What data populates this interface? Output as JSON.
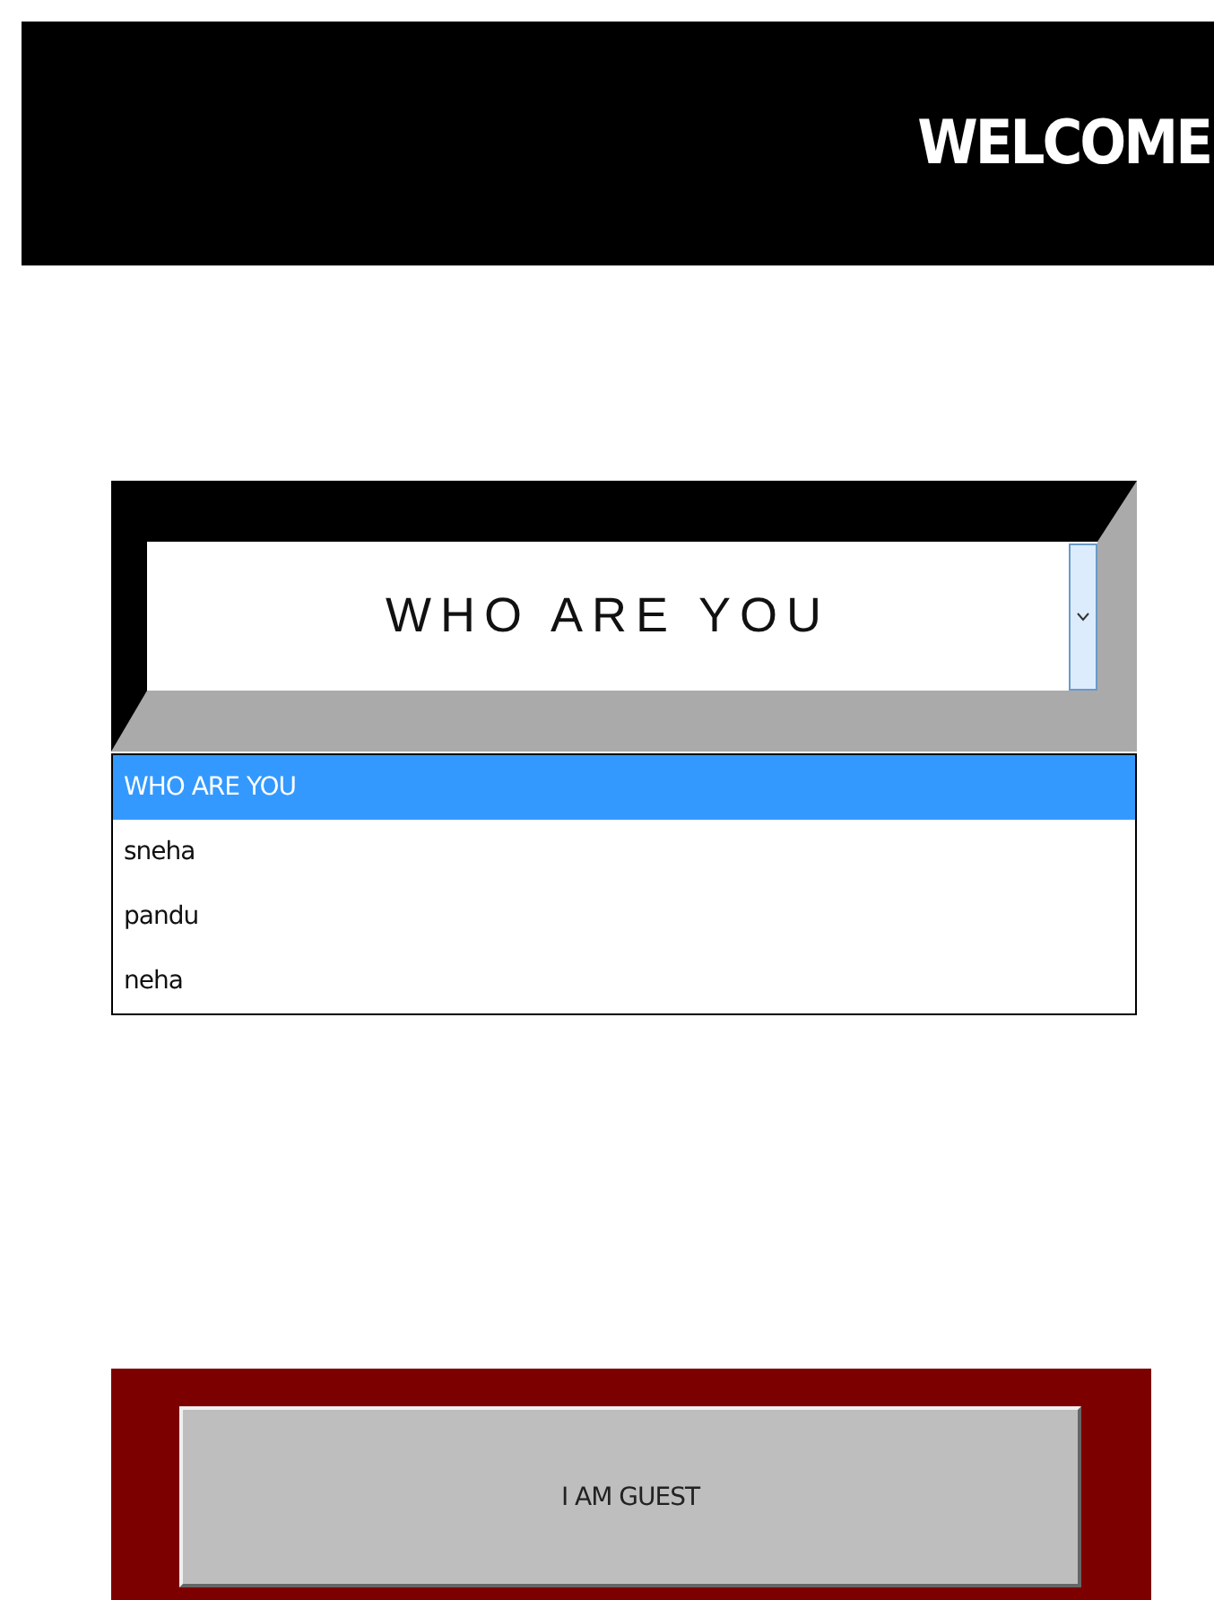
{
  "header": {
    "title": "WELCOME"
  },
  "select": {
    "value": "WHO ARE YOU",
    "expanded": true,
    "options": [
      {
        "label": "WHO ARE YOU",
        "selected": true
      },
      {
        "label": "sneha",
        "selected": false
      },
      {
        "label": "pandu",
        "selected": false
      },
      {
        "label": "neha",
        "selected": false
      }
    ]
  },
  "guest_button": {
    "label": "I AM GUEST"
  }
}
